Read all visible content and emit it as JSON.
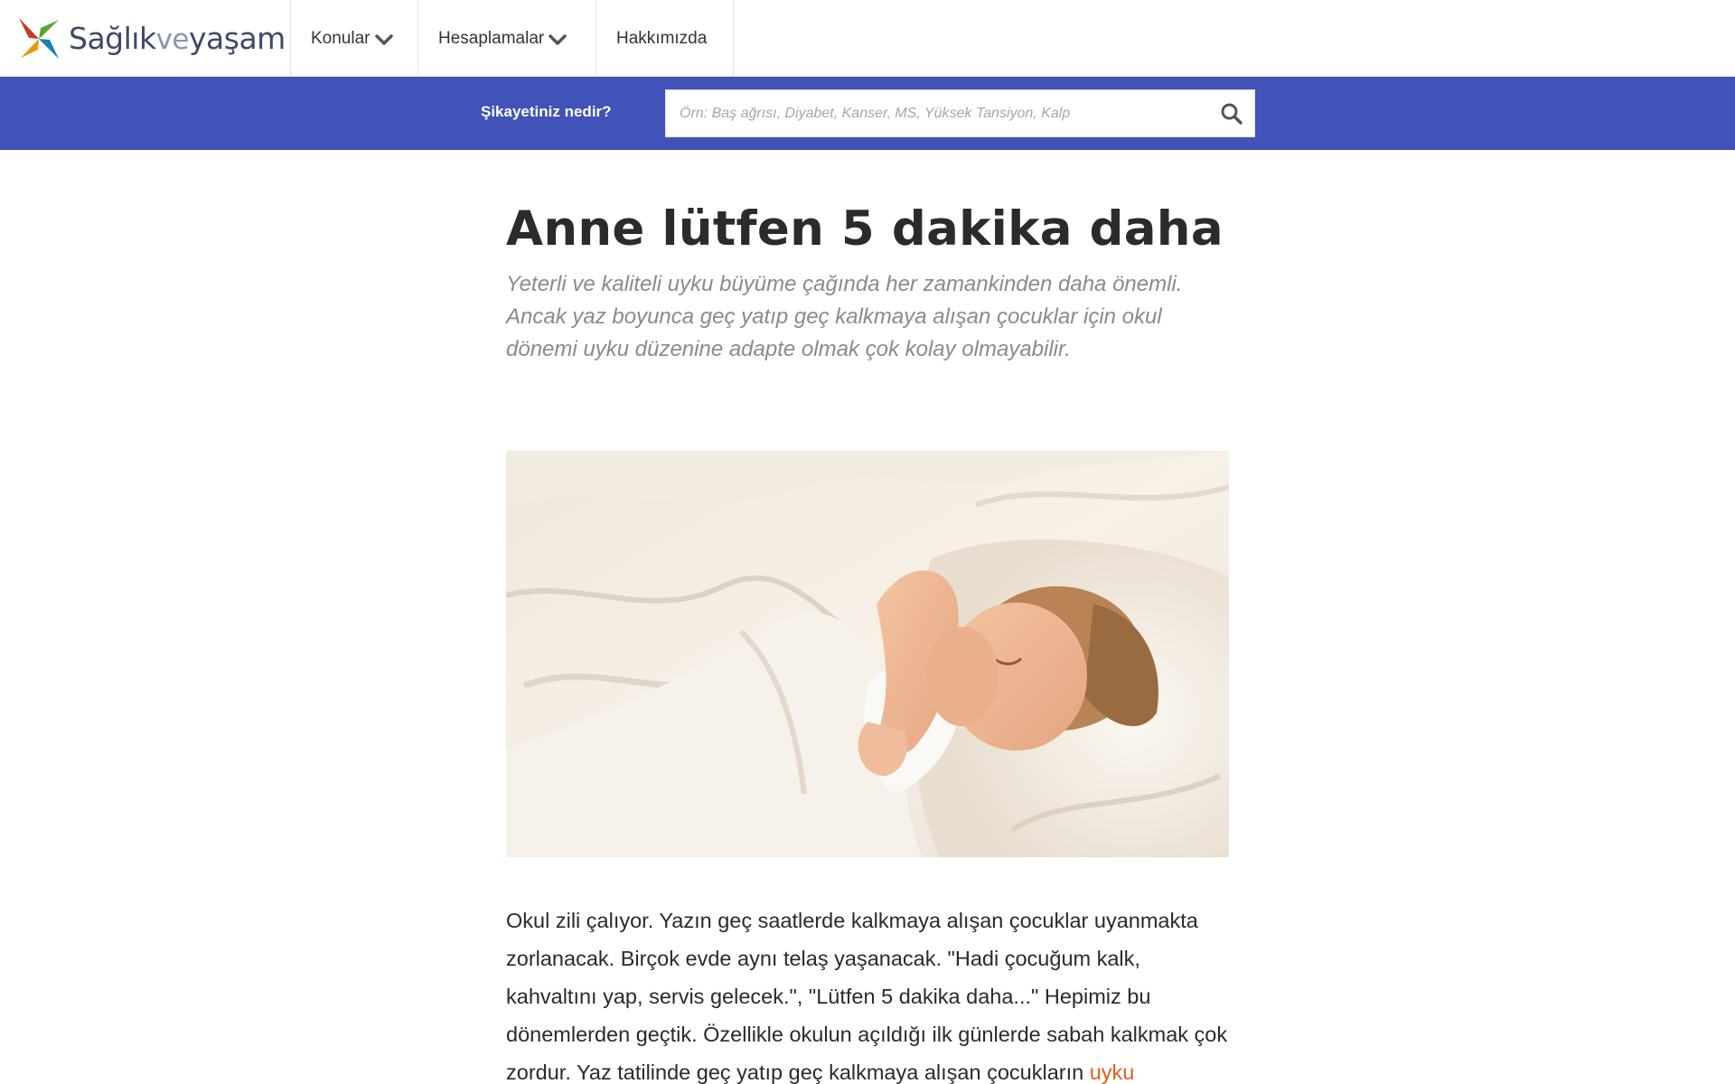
{
  "header": {
    "logo": {
      "part1": "Sağlık",
      "part2": "ve",
      "part3": "yaşam"
    },
    "nav": {
      "konular": "Konular",
      "hesaplamalar": "Hesaplamalar",
      "hakkimizda": "Hakkımızda"
    }
  },
  "search": {
    "label": "Şikayetiniz nedir?",
    "placeholder": "Örn: Baş ağrısı, Diyabet, Kanser, MS, Yüksek Tansiyon, Kalp",
    "value": ""
  },
  "article": {
    "title": "Anne lütfen 5 dakika daha",
    "lead": "Yeterli ve kaliteli uyku büyüme çağında her zamankinden daha önemli. Ancak yaz boyunca geç yatıp geç kalkmaya alışan çocuklar için okul dönemi uyku düzenine adapte olmak çok kolay olmayabilir.",
    "paragraph_text": "Okul zili çalıyor. Yazın geç saatlerde kalkmaya alışan çocuklar uyanmakta zorlanacak. Birçok evde aynı telaş yaşanacak. \"Hadi çocuğum kalk, kahvaltını yap, servis gelecek.\", \"Lütfen 5 dakika daha...\" Hepimiz bu dönemlerden geçtik. Özellikle okulun açıldığı ilk günlerde sabah kalkmak çok zordur. Yaz tatilinde geç yatıp geç kalkmaya alışan çocukların ",
    "paragraph_link": "uyku"
  },
  "colors": {
    "search_band": "#4152b8",
    "link": "#e55c18",
    "title": "#2b2b2b",
    "lead": "#8a8a8a"
  },
  "icons": {
    "logo": "pinwheel-logo-icon",
    "dropdown": "chevron-down-icon",
    "search": "search-icon"
  }
}
